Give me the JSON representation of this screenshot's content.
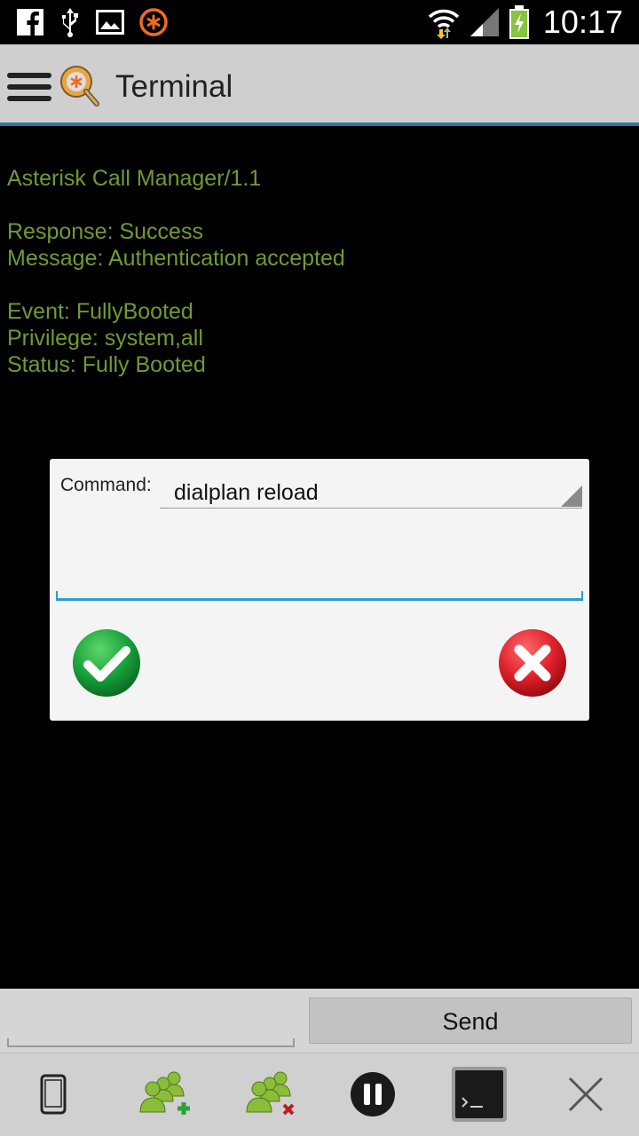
{
  "status_bar": {
    "time": "10:17",
    "left_icons": [
      "facebook-icon",
      "usb-icon",
      "gallery-icon",
      "asterisk-icon"
    ],
    "right_icons": [
      "wifi-icon",
      "signal-icon",
      "battery-charging-icon"
    ]
  },
  "action_bar": {
    "title": "Terminal",
    "menu_icon": "hamburger-menu-icon",
    "app_icon": "app-logo-icon"
  },
  "terminal": {
    "color": "#6f9a36",
    "lines": [
      "Asterisk Call Manager/1.1",
      "",
      "Response: Success",
      "Message: Authentication accepted",
      "",
      "Event: FullyBooted",
      "Privilege: system,all",
      "Status: Fully Booted"
    ]
  },
  "dialog": {
    "command_label": "Command:",
    "command_value": "dialplan reload",
    "ok_icon": "green-check-icon",
    "cancel_icon": "red-x-icon"
  },
  "input_row": {
    "send_label": "Send",
    "message_value": ""
  },
  "toolbar": {
    "items": [
      "phone-icon",
      "add-users-icon",
      "remove-users-icon",
      "pause-icon",
      "terminal-icon",
      "close-icon"
    ]
  }
}
